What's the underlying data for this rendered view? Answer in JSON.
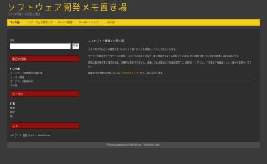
{
  "site": {
    "title": "ソフトウェア開発メモ置き場",
    "tagline": "日々の作業メモと覚え書き"
  },
  "nav": {
    "items": [
      {
        "label": "ITメモ帳"
      },
      {
        "label": "ソフトウェア開発メモ"
      },
      {
        "label": "サーバー関連"
      },
      {
        "label": "データベースメモ"
      },
      {
        "label": "その他"
      }
    ]
  },
  "search": {
    "label": "検索:",
    "input_value": "",
    "placeholder": "",
    "button_label": "検索"
  },
  "widgets": {
    "recent_title": "最近の投稿",
    "recent_posts": [
      "ITメモ帳",
      "ソフトウェア開発メモのまとめ",
      "サーバー関連",
      "データベース接続メモ",
      "その他"
    ],
    "categories_title": "カテゴリー",
    "categories": [
      "IT系",
      "開発",
      "雑記",
      "他"
    ],
    "meta_title": "メタ",
    "meta_links": "ログイン  投稿  コメント  WordPress"
  },
  "main": {
    "post_title": "ソフトウェア開発メモ置き場",
    "paragraphs": [
      "このブログでは日々の開発で気づいたことや調べたことを簡単にメモとして残しています。",
      "サーバーの設定やデータベースの操作、プログラムの書き方など、後で見返せるように記録しています。同じ問題で困っている方の参考になれば幸いです。",
      "内容は個人的な覚え書きのため、正確性は保証できません。参考にされる場合はご自身の環境でよく確認してください。ご意見やご指摘はコメント欄からお寄せください。"
    ],
    "link_sentence_before": "最新のITメモ帳の記事については",
    "link_text": "こちらのカテゴリー",
    "link_sentence_after": "からご覧いただけます。"
  },
  "footer": {
    "text": "Proudly powered by WordPress / Theme by Misc"
  }
}
